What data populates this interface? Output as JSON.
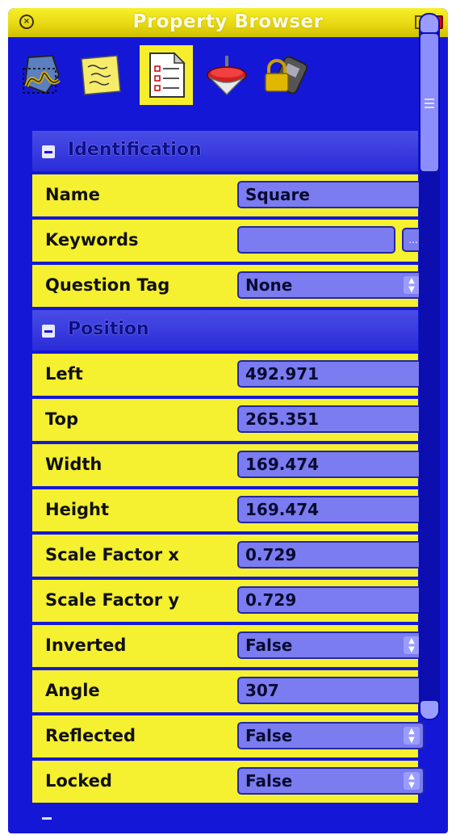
{
  "window": {
    "title": "Property Browser"
  },
  "toolbar": {
    "tools": [
      {
        "icon": "signature-shapes-icon"
      },
      {
        "icon": "sticky-note-icon"
      },
      {
        "icon": "properties-document-icon",
        "active": true
      },
      {
        "icon": "spinning-top-icon"
      },
      {
        "icon": "lock-device-icon"
      }
    ]
  },
  "sections": {
    "identification": {
      "title": "Identification",
      "rows": {
        "name": {
          "label": "Name",
          "value": "Square"
        },
        "keywords": {
          "label": "Keywords",
          "value": "",
          "button": "..."
        },
        "question_tag": {
          "label": "Question Tag",
          "value": "None"
        }
      }
    },
    "position": {
      "title": "Position",
      "rows": {
        "left": {
          "label": "Left",
          "value": "492.971"
        },
        "top": {
          "label": "Top",
          "value": "265.351"
        },
        "width": {
          "label": "Width",
          "value": "169.474"
        },
        "height": {
          "label": "Height",
          "value": "169.474"
        },
        "scale_x": {
          "label": "Scale Factor x",
          "value": "0.729"
        },
        "scale_y": {
          "label": "Scale Factor y",
          "value": "0.729"
        },
        "inverted": {
          "label": "Inverted",
          "value": "False"
        },
        "angle": {
          "label": "Angle",
          "value": "307"
        },
        "reflected": {
          "label": "Reflected",
          "value": "False"
        },
        "locked": {
          "label": "Locked",
          "value": "False"
        }
      }
    }
  },
  "colors": {
    "window_bg": "#1418d6",
    "row_bg": "#f5f030",
    "field_bg": "#7a7cf0",
    "title_bar": "#e6d610"
  }
}
